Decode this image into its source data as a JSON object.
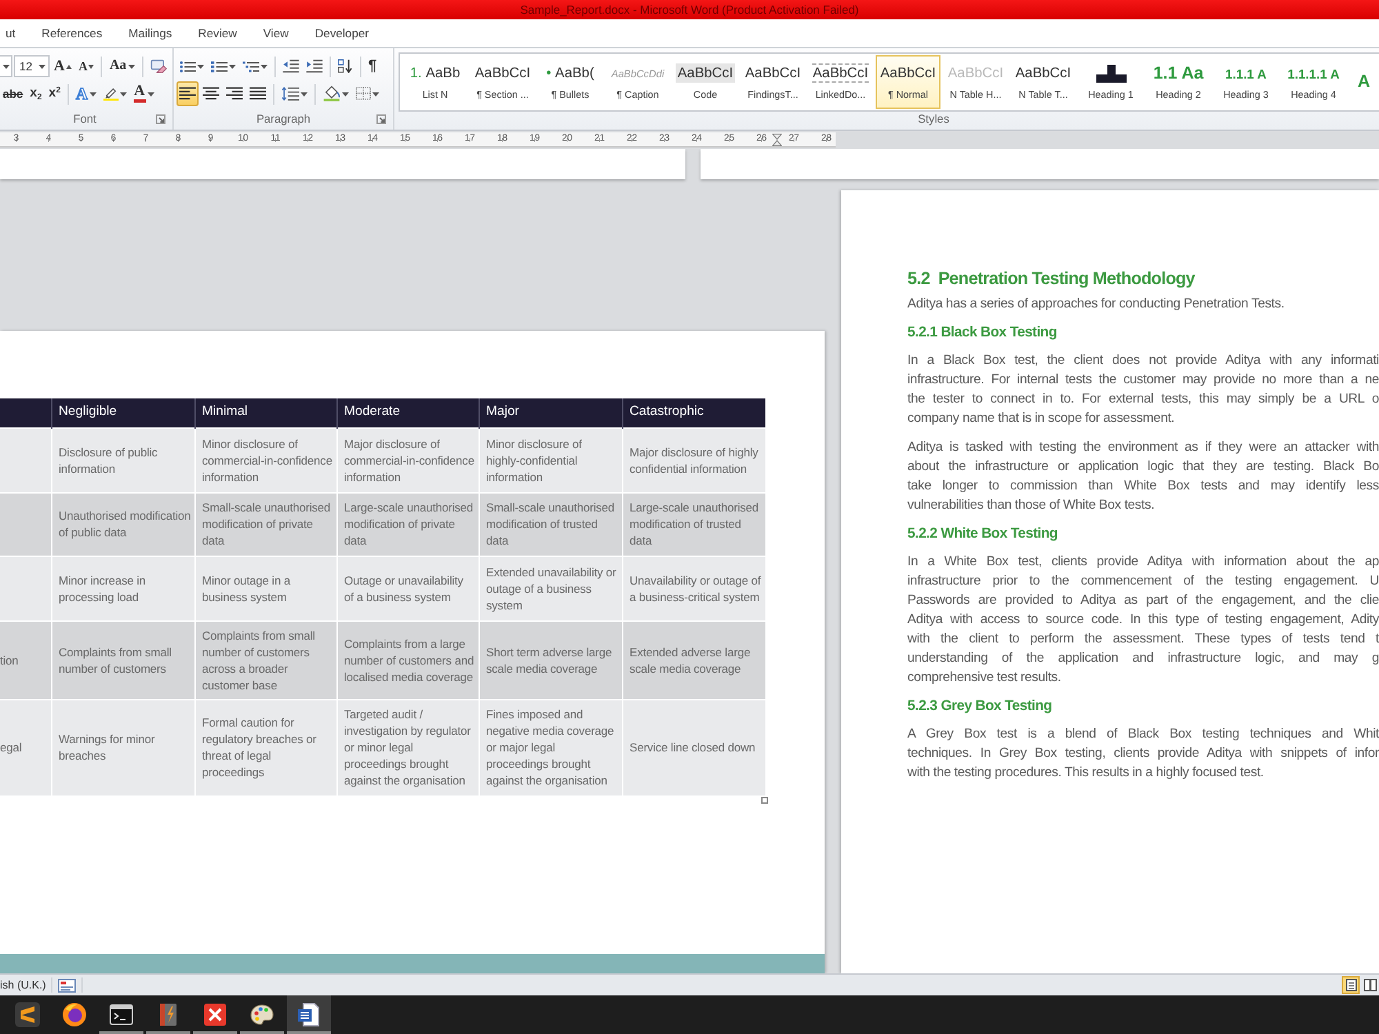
{
  "title_bar": {
    "title": "Sample_Report.docx - Microsoft Word (Product Activation Failed)"
  },
  "ribbon_tabs": [
    {
      "label": "ut",
      "selected": false
    },
    {
      "label": "References",
      "selected": false
    },
    {
      "label": "Mailings",
      "selected": false
    },
    {
      "label": "Review",
      "selected": false
    },
    {
      "label": "View",
      "selected": false
    },
    {
      "label": "Developer",
      "selected": false
    }
  ],
  "font_group": {
    "label": "Font",
    "font_size": "12",
    "row_1": [
      {
        "kind": "grow",
        "glyph": "A"
      },
      {
        "kind": "shrink",
        "glyph": "A"
      },
      {
        "kind": "change-case",
        "glyph": "Aa"
      },
      {
        "kind": "clear-formatting"
      }
    ],
    "row_2": [
      {
        "kind": "strikethrough",
        "glyph": "abc"
      },
      {
        "kind": "subscript",
        "glyph": "x$_{2}$"
      },
      {
        "kind": "superscript",
        "glyph": "x$^{2}$"
      },
      {
        "kind": "text-effects",
        "glyph": "A"
      },
      {
        "kind": "highlight"
      },
      {
        "kind": "font-color",
        "glyph": "A"
      }
    ]
  },
  "paragraph_group": {
    "label": "Paragraph",
    "row_1": [
      {
        "kind": "bullets"
      },
      {
        "kind": "numbering"
      },
      {
        "kind": "multilevel"
      },
      {
        "kind": "decrease-indent"
      },
      {
        "kind": "increase-indent"
      },
      {
        "kind": "sort"
      },
      {
        "kind": "show-marks",
        "glyph": "¶"
      }
    ],
    "alignment": [
      {
        "kind": "left",
        "selected": true
      },
      {
        "kind": "center",
        "selected": false
      },
      {
        "kind": "right",
        "selected": false
      },
      {
        "kind": "justify",
        "selected": false
      }
    ],
    "row_2": [
      {
        "kind": "line-spacing"
      },
      {
        "kind": "shading"
      },
      {
        "kind": "borders"
      }
    ]
  },
  "styles_group": {
    "label": "Styles",
    "items": [
      {
        "kind": "list",
        "marker": "1.",
        "preview": "AaBb",
        "label": "List N",
        "selected": false
      },
      {
        "kind": "plain",
        "preview": "AaBbCcI",
        "label": "¶ Section ...",
        "selected": false
      },
      {
        "kind": "bullet",
        "marker": "•",
        "preview": "AaBb(",
        "label": "¶ Bullets",
        "selected": false
      },
      {
        "kind": "caption",
        "preview": "AaBbCcDdi",
        "label": "¶ Caption",
        "selected": false
      },
      {
        "kind": "code",
        "preview": "AaBbCcI",
        "label": "Code",
        "selected": false
      },
      {
        "kind": "plain",
        "preview": "AaBbCcI",
        "label": "FindingsT...",
        "selected": false
      },
      {
        "kind": "linked",
        "preview": "AaBbCcI",
        "label": "LinkedDo...",
        "selected": false
      },
      {
        "kind": "plain",
        "preview": "AaBbCcI",
        "label": "¶ Normal",
        "selected": true
      },
      {
        "kind": "faded",
        "preview": "AaBbCcI",
        "label": "N Table H...",
        "selected": false
      },
      {
        "kind": "plain",
        "preview": "AaBbCcI",
        "label": "N Table T...",
        "selected": false
      },
      {
        "kind": "block",
        "label": "Heading 1",
        "selected": false
      },
      {
        "kind": "heading-large",
        "preview": "1.1 Aa",
        "label": "Heading 2",
        "selected": false
      },
      {
        "kind": "heading-small",
        "preview": "1.1.1 A",
        "label": "Heading 3",
        "selected": false
      },
      {
        "kind": "heading-small",
        "preview": "1.1.1.1 A",
        "label": "Heading 4",
        "selected": false
      },
      {
        "kind": "heading-large",
        "preview": "A",
        "selected": false
      }
    ]
  },
  "ruler": {
    "marks": [
      "3",
      "4",
      "5",
      "6",
      "7",
      "8",
      "9",
      "10",
      "11",
      "12",
      "13",
      "14",
      "15",
      "16",
      "17",
      "18",
      "19",
      "20",
      "21",
      "22",
      "23",
      "24",
      "25",
      "26",
      "27",
      "28"
    ]
  },
  "table": {
    "columns": [
      "Negligible",
      "Minimal",
      "Moderate",
      "Major",
      "Catastrophic"
    ],
    "rows": [
      {
        "cells": [
          "Disclosure of public information",
          "Minor disclosure of commercial-in-confidence information",
          "Major disclosure of commercial-in-confidence information",
          "Minor disclosure of highly-confidential information",
          "Major disclosure of highly confidential information"
        ]
      },
      {
        "cells": [
          "Unauthorised modification of public data",
          "Small-scale unauthorised modification of private data",
          "Large-scale unauthorised modification of private data",
          "Small-scale unauthorised modification of trusted data",
          "Large-scale unauthorised modification of trusted data"
        ]
      },
      {
        "cells": [
          "Minor increase in processing load",
          "Minor outage in a business system",
          "Outage or unavailability of a business system",
          "Extended unavailability or outage of a business system",
          "Unavailability or outage of a business-critical system"
        ]
      },
      {
        "column_1": "tion",
        "cells": [
          "Complaints from small number of customers",
          "Complaints from small number of customers across a broader customer base",
          "Complaints from a large number of customers and localised media coverage",
          "Short term adverse large scale media coverage",
          "Extended adverse large scale media coverage"
        ]
      },
      {
        "column_1": "egal",
        "cells": [
          "Warnings for minor breaches",
          "Formal caution for regulatory breaches or threat of legal proceedings",
          "Targeted audit / investigation by regulator or minor legal proceedings brought against the organisation",
          "Fines imposed and negative media coverage or major legal proceedings brought against the organisation",
          "Service line closed down"
        ]
      }
    ]
  },
  "right_page": {
    "heading": {
      "number": "5.2",
      "title": "Penetration Testing Methodology"
    },
    "blocks": [
      {
        "kind": "paragraph",
        "lines": [
          "Aditya has a series of approaches for conducting Penetration Tests."
        ]
      },
      {
        "kind": "subheading",
        "text": "5.2.1 Black Box Testing"
      },
      {
        "kind": "paragraph",
        "lines": [
          "In a Black Box test, the client does not provide Aditya with any informati",
          "infrastructure. For internal tests the customer may provide no more than a ne",
          "the tester to connect in to. For external tests, this may simply be a URL o",
          "company name that is in scope for assessment."
        ]
      },
      {
        "kind": "paragraph",
        "lines": [
          "Aditya is tasked with testing the environment as if they were an attacker with",
          "about the infrastructure or application logic that they are testing. Black Bo",
          "take longer to commission than White Box tests and may identify less",
          "vulnerabilities than those of White Box tests."
        ]
      },
      {
        "kind": "subheading",
        "text": "5.2.2 White Box Testing"
      },
      {
        "kind": "paragraph",
        "lines": [
          "In a White Box test, clients provide Aditya with information about the ap",
          "infrastructure prior to the commencement of the testing engagement. U",
          "Passwords are provided to Aditya as part of the engagement, and the clie",
          "Aditya with access to source code. In this type of testing engagement, Adity",
          "with the client to perform the assessment. These types of tests tend t",
          "understanding of the application and infrastructure logic, and may g",
          "comprehensive test results."
        ]
      },
      {
        "kind": "subheading",
        "text": "5.2.3 Grey Box Testing"
      },
      {
        "kind": "paragraph",
        "lines": [
          "A Grey Box test is a blend of Black Box testing techniques and Whit",
          "techniques. In Grey Box testing, clients provide Aditya with snippets of infor",
          "with the testing procedures. This results in a highly focused test."
        ]
      }
    ]
  },
  "status_bar": {
    "language": "ish (U.K.)",
    "views": [
      {
        "kind": "print-layout",
        "selected": true
      },
      {
        "kind": "full-screen",
        "selected": false
      }
    ]
  },
  "taskbar": {
    "apps": [
      {
        "kind": "editor",
        "running": false,
        "selected": false
      },
      {
        "kind": "browser",
        "running": false,
        "selected": false
      },
      {
        "kind": "terminal",
        "running": true,
        "selected": false
      },
      {
        "kind": "book",
        "running": true,
        "selected": false
      },
      {
        "kind": "x-app",
        "running": true,
        "selected": false
      },
      {
        "kind": "paint",
        "running": true,
        "selected": false
      },
      {
        "kind": "word-processor",
        "running": true,
        "selected": true
      }
    ]
  }
}
